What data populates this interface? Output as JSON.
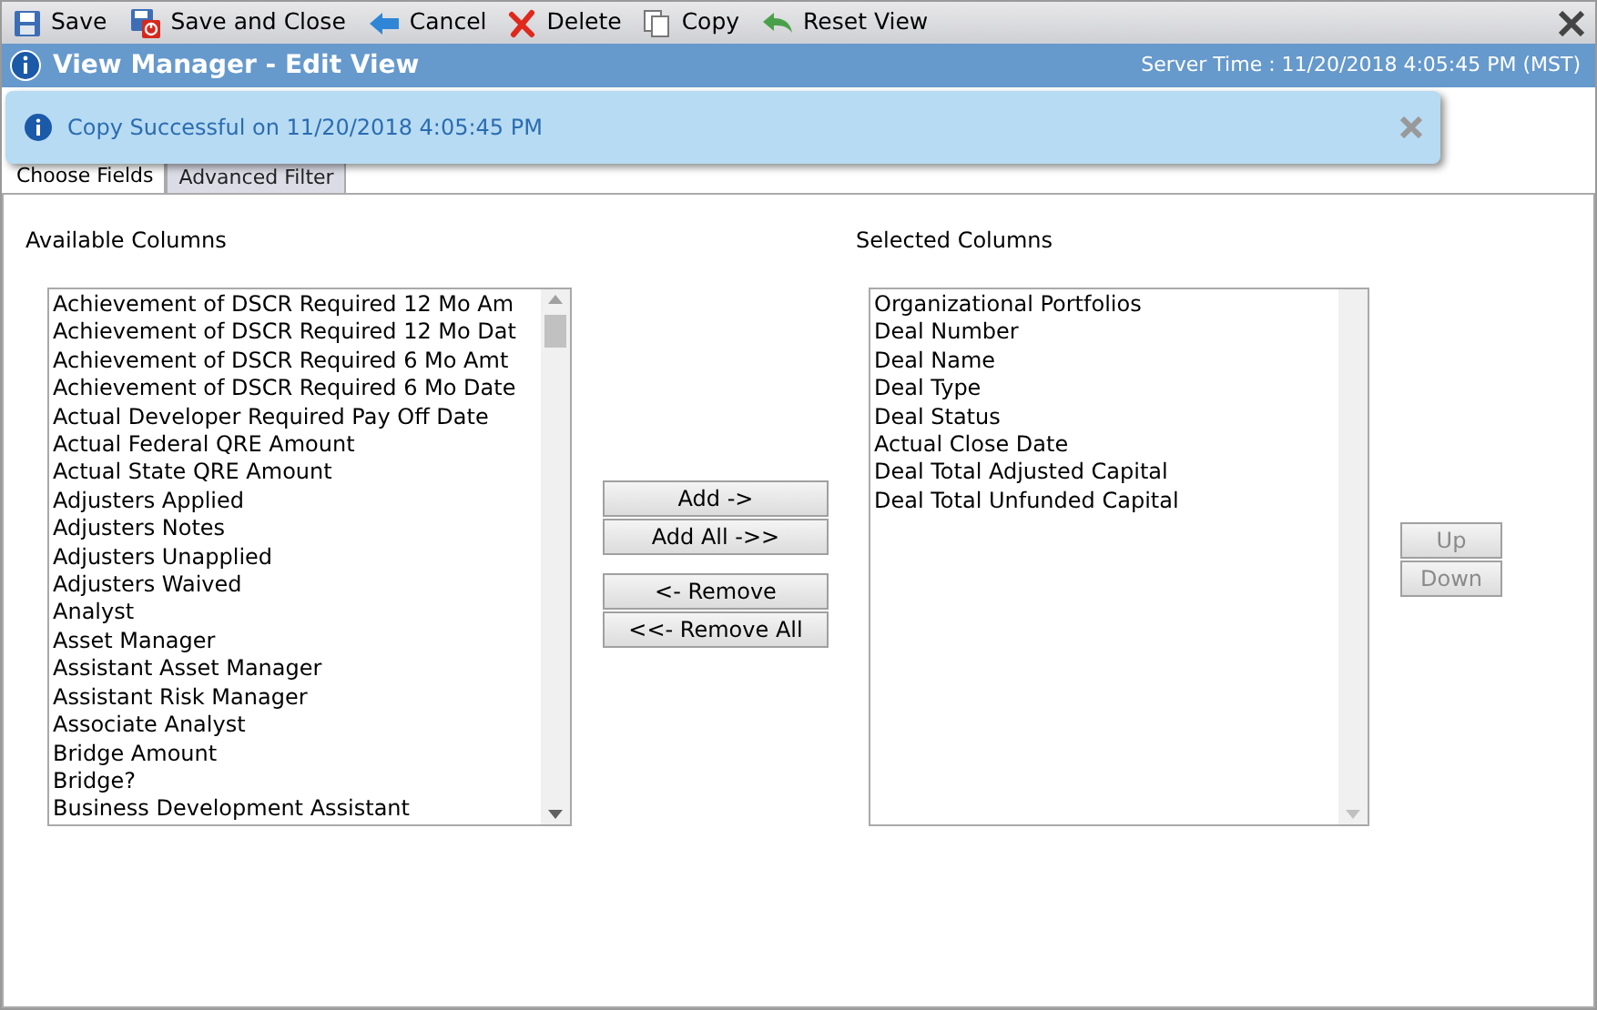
{
  "toolbar": [
    {
      "label": "Save",
      "kind": "save"
    },
    {
      "label": "Save and Close",
      "kind": "saveclose"
    },
    {
      "label": "Cancel",
      "kind": "cancel"
    },
    {
      "label": "Delete",
      "kind": "delete"
    },
    {
      "label": "Copy",
      "kind": "copy"
    },
    {
      "label": "Reset View",
      "kind": "reset"
    }
  ],
  "window": {
    "title": "View Manager - Edit View",
    "server_time": "Server Time : 11/20/2018 4:05:45 PM (MST)"
  },
  "notification": {
    "message": "Copy Successful on 11/20/2018 4:05:45 PM"
  },
  "tabs": [
    {
      "label": "Choose Fields",
      "selected": true
    },
    {
      "label": "Advanced Filter",
      "selected": false
    }
  ],
  "available": {
    "label": "Available Columns",
    "items": [
      "Achievement of DSCR Required 12 Mo Am",
      "Achievement of DSCR Required 12 Mo Dat",
      "Achievement of DSCR Required 6 Mo Amt",
      "Achievement of DSCR Required 6 Mo Date",
      "Actual Developer Required Pay Off Date",
      "Actual Federal QRE Amount",
      "Actual State QRE Amount",
      "Adjusters Applied",
      "Adjusters Notes",
      "Adjusters Unapplied",
      "Adjusters Waived",
      "Analyst",
      "Asset Manager",
      "Assistant Asset Manager",
      "Assistant Risk Manager",
      "Associate Analyst",
      "Bridge Amount",
      "Bridge?",
      "Business Development Assistant"
    ]
  },
  "move_buttons": [
    [
      "Add ->",
      "Add All ->>"
    ],
    [
      "<- Remove",
      "<<- Remove All"
    ]
  ],
  "selected": {
    "label": "Selected Columns",
    "items": [
      "Organizational Portfolios",
      "Deal Number",
      "Deal Name",
      "Deal Type",
      "Deal Status",
      "Actual Close Date",
      "Deal Total Adjusted Capital",
      "Deal Total Unfunded Capital"
    ]
  },
  "order_buttons": [
    {
      "label": "Up",
      "disabled": true
    },
    {
      "label": "Down",
      "disabled": true
    }
  ]
}
